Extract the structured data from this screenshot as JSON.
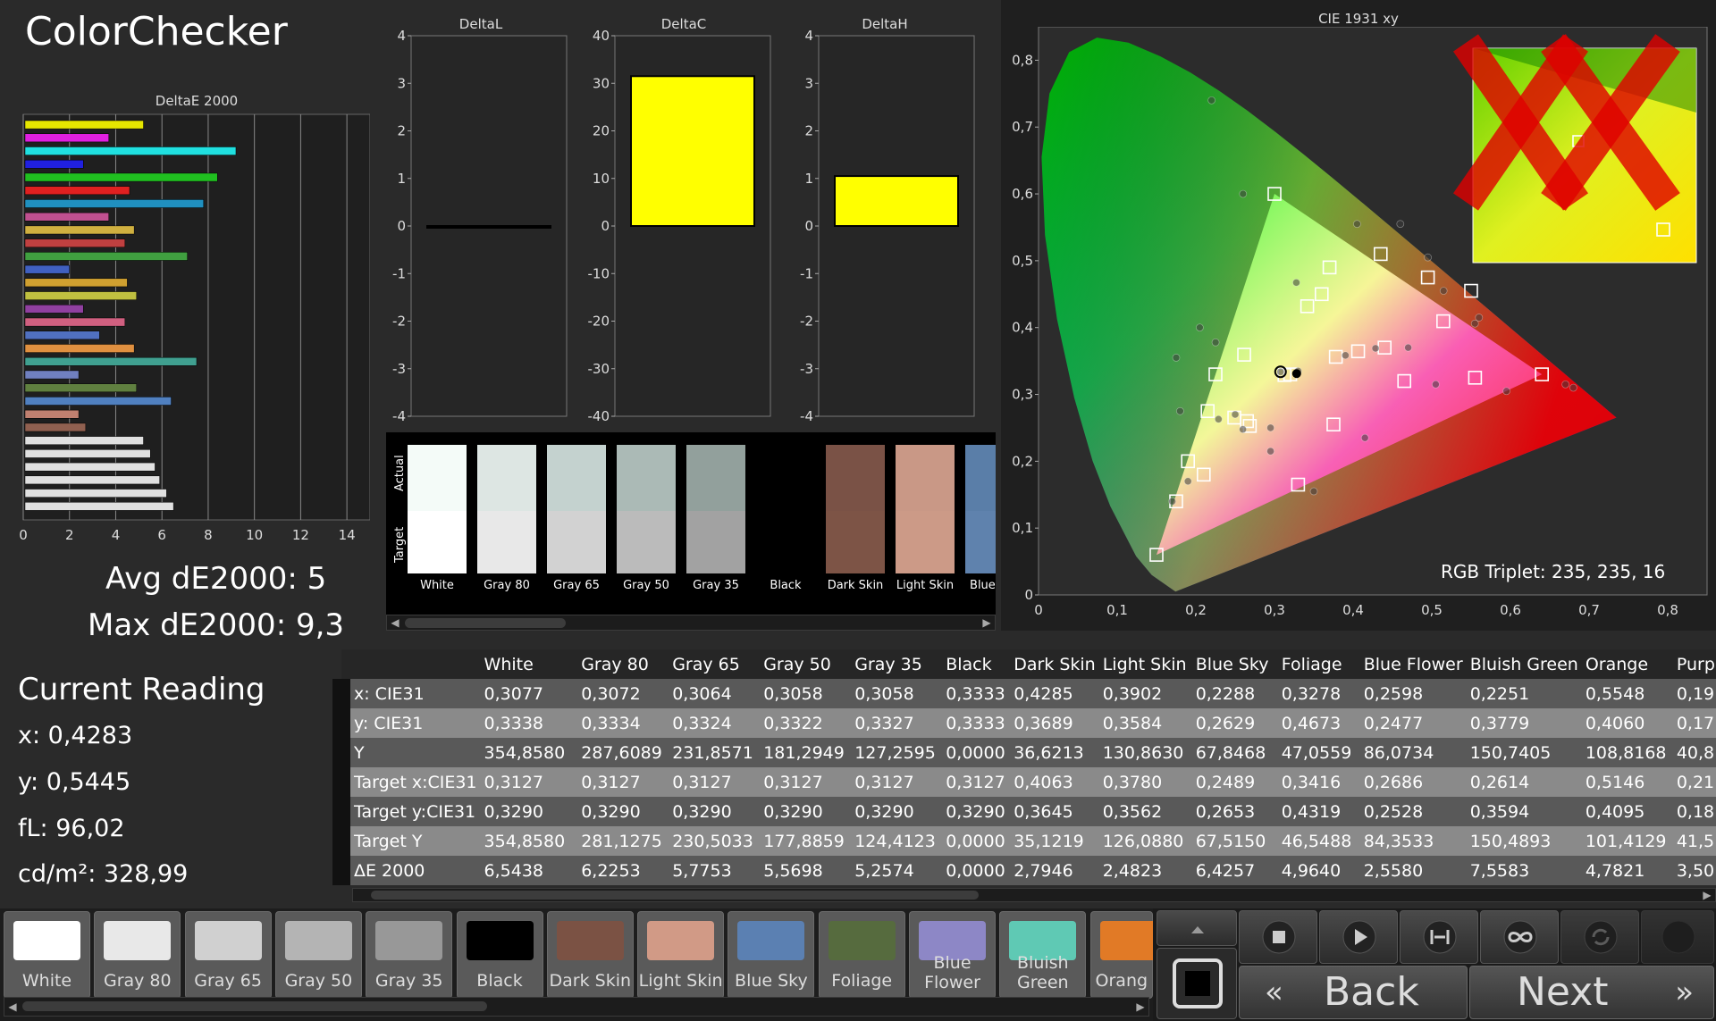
{
  "app": {
    "title": "ColorChecker"
  },
  "charts": {
    "deltae": {
      "title": "DeltaE 2000",
      "xticks": [
        "0",
        "2",
        "4",
        "6",
        "8",
        "10",
        "12",
        "14"
      ],
      "xmax": 15
    },
    "deltal": {
      "title": "DeltaL",
      "yticks": [
        "4",
        "3",
        "2",
        "1",
        "0",
        "-1",
        "-2",
        "-3",
        "-4"
      ],
      "ymin": -4,
      "ymax": 4,
      "value": 0.0,
      "color": "#111111"
    },
    "deltac": {
      "title": "DeltaC",
      "yticks": [
        "40",
        "30",
        "20",
        "10",
        "0",
        "-10",
        "-20",
        "-30",
        "-40"
      ],
      "ymin": -40,
      "ymax": 40,
      "value": 31.5,
      "color": "#ffff00"
    },
    "deltah": {
      "title": "DeltaH",
      "yticks": [
        "4",
        "3",
        "2",
        "1",
        "0",
        "-1",
        "-2",
        "-3",
        "-4"
      ],
      "ymin": -4,
      "ymax": 4,
      "value": 1.05,
      "color": "#ffff00"
    },
    "cie": {
      "title": "CIE 1931 xy",
      "xticks": [
        "0",
        "0,1",
        "0,2",
        "0,3",
        "0,4",
        "0,5",
        "0,6",
        "0,7",
        "0,8"
      ],
      "yticks": [
        "0,8",
        "0,7",
        "0,6",
        "0,5",
        "0,4",
        "0,3",
        "0,2",
        "0,1",
        "0"
      ],
      "rgb_triplet": "RGB Triplet: 235, 235, 16"
    }
  },
  "chart_data": [
    {
      "type": "bar",
      "title": "DeltaE 2000",
      "orientation": "horizontal",
      "xlim": [
        0,
        15
      ],
      "values": [
        5.2,
        3.7,
        9.2,
        2.6,
        8.4,
        4.6,
        7.8,
        3.7,
        4.8,
        4.4,
        7.1,
        2.0,
        4.5,
        4.9,
        2.6,
        4.4,
        3.3,
        4.8,
        7.5,
        2.4,
        4.9,
        6.4,
        2.4,
        2.7,
        5.2,
        5.5,
        5.7,
        5.9,
        6.2,
        6.5
      ],
      "colors": [
        "#e6e600",
        "#e020e0",
        "#20e0e0",
        "#2020e0",
        "#20c020",
        "#e02020",
        "#2090c0",
        "#c05090",
        "#d0b040",
        "#c04040",
        "#40a040",
        "#4060c0",
        "#d0a030",
        "#c0c040",
        "#9040a0",
        "#d06080",
        "#5070c0",
        "#e09040",
        "#40a090",
        "#7080c0",
        "#608040",
        "#5080c0",
        "#c08070",
        "#906050",
        "#e0e0e0",
        "#e0e0e0",
        "#e0e0e0",
        "#e0e0e0",
        "#e0e0e0",
        "#e0e0e0"
      ]
    },
    {
      "type": "bar",
      "title": "DeltaL",
      "categories": [
        ""
      ],
      "values": [
        0.0
      ],
      "ylim": [
        -4,
        4
      ]
    },
    {
      "type": "bar",
      "title": "DeltaC",
      "categories": [
        ""
      ],
      "values": [
        31.5
      ],
      "ylim": [
        -40,
        40
      ]
    },
    {
      "type": "bar",
      "title": "DeltaH",
      "categories": [
        ""
      ],
      "values": [
        1.05
      ],
      "ylim": [
        -4,
        4
      ]
    },
    {
      "type": "scatter",
      "title": "CIE 1931 xy",
      "xlim": [
        0,
        0.85
      ],
      "ylim": [
        0,
        0.85
      ],
      "gamut_triangle": [
        [
          0.64,
          0.33
        ],
        [
          0.3,
          0.6
        ],
        [
          0.15,
          0.06
        ]
      ],
      "targets": [
        [
          0.3127,
          0.329
        ],
        [
          0.4063,
          0.3645
        ],
        [
          0.378,
          0.3562
        ],
        [
          0.2489,
          0.2653
        ],
        [
          0.3416,
          0.4319
        ],
        [
          0.2686,
          0.2528
        ],
        [
          0.2614,
          0.3594
        ],
        [
          0.5146,
          0.4095
        ],
        [
          0.21,
          0.18
        ],
        [
          0.64,
          0.33
        ],
        [
          0.3,
          0.6
        ],
        [
          0.15,
          0.06
        ],
        [
          0.225,
          0.33
        ],
        [
          0.32,
          0.33
        ],
        [
          0.37,
          0.49
        ],
        [
          0.435,
          0.51
        ],
        [
          0.495,
          0.475
        ],
        [
          0.55,
          0.455
        ],
        [
          0.36,
          0.45
        ],
        [
          0.175,
          0.14
        ],
        [
          0.19,
          0.2
        ],
        [
          0.215,
          0.275
        ],
        [
          0.265,
          0.26
        ],
        [
          0.375,
          0.255
        ],
        [
          0.33,
          0.165
        ],
        [
          0.44,
          0.37
        ],
        [
          0.465,
          0.32
        ],
        [
          0.555,
          0.325
        ]
      ],
      "measured": [
        [
          0.3077,
          0.3338
        ],
        [
          0.4285,
          0.3689
        ],
        [
          0.3902,
          0.3584
        ],
        [
          0.2288,
          0.2629
        ],
        [
          0.3278,
          0.4673
        ],
        [
          0.2598,
          0.2477
        ],
        [
          0.2251,
          0.3779
        ],
        [
          0.5548,
          0.406
        ],
        [
          0.19,
          0.17
        ],
        [
          0.68,
          0.31
        ],
        [
          0.22,
          0.74
        ],
        [
          0.17,
          0.14
        ],
        [
          0.175,
          0.355
        ],
        [
          0.33,
          0.335
        ],
        [
          0.405,
          0.555
        ],
        [
          0.46,
          0.555
        ],
        [
          0.495,
          0.505
        ],
        [
          0.515,
          0.455
        ],
        [
          0.56,
          0.415
        ],
        [
          0.26,
          0.6
        ],
        [
          0.205,
          0.4
        ],
        [
          0.18,
          0.275
        ],
        [
          0.25,
          0.27
        ],
        [
          0.295,
          0.25
        ],
        [
          0.295,
          0.215
        ],
        [
          0.415,
          0.235
        ],
        [
          0.47,
          0.37
        ],
        [
          0.35,
          0.155
        ],
        [
          0.505,
          0.315
        ],
        [
          0.595,
          0.305
        ],
        [
          0.67,
          0.315
        ]
      ],
      "current": [
        0.3077,
        0.3338
      ]
    }
  ],
  "swatches": {
    "actual_label": "Actual",
    "target_label": "Target",
    "items": [
      {
        "label": "White",
        "actual": "#f4fbf8",
        "target": "#ffffff"
      },
      {
        "label": "Gray 80",
        "actual": "#dde6e3",
        "target": "#e8e8e8"
      },
      {
        "label": "Gray 65",
        "actual": "#c4d2cf",
        "target": "#d2d2d2"
      },
      {
        "label": "Gray 50",
        "actual": "#abbab6",
        "target": "#bbbbbb"
      },
      {
        "label": "Gray 35",
        "actual": "#92a09c",
        "target": "#a2a2a2"
      },
      {
        "label": "Black",
        "actual": "#000000",
        "target": "#000000"
      },
      {
        "label": "Dark Skin",
        "actual": "#7a5246",
        "target": "#7d5446"
      },
      {
        "label": "Light Skin",
        "actual": "#c99886",
        "target": "#cc9a87"
      },
      {
        "label": "Blue Sky",
        "actual": "#5a7ea8",
        "target": "#5f82ad"
      }
    ]
  },
  "stats": {
    "avg": "Avg dE2000: 5",
    "max": "Max dE2000: 9,3"
  },
  "current_reading": {
    "title": "Current Reading",
    "x": "x: 0,4283",
    "y": "y: 0,5445",
    "fl": "fL: 96,02",
    "cdm2": "cd/m²: 328,99"
  },
  "table": {
    "headers": [
      "",
      "White",
      "Gray 80",
      "Gray 65",
      "Gray 50",
      "Gray 35",
      "Black",
      "Dark Skin",
      "Light Skin",
      "Blue Sky",
      "Foliage",
      "Blue Flower",
      "Bluish Green",
      "Orange",
      "Purp"
    ],
    "rows": [
      [
        "x: CIE31",
        "0,3077",
        "0,3072",
        "0,3064",
        "0,3058",
        "0,3058",
        "0,3333",
        "0,4285",
        "0,3902",
        "0,2288",
        "0,3278",
        "0,2598",
        "0,2251",
        "0,5548",
        "0,19"
      ],
      [
        "y: CIE31",
        "0,3338",
        "0,3334",
        "0,3324",
        "0,3322",
        "0,3327",
        "0,3333",
        "0,3689",
        "0,3584",
        "0,2629",
        "0,4673",
        "0,2477",
        "0,3779",
        "0,4060",
        "0,17"
      ],
      [
        "Y",
        "354,8580",
        "287,6089",
        "231,8571",
        "181,2949",
        "127,2595",
        "0,0000",
        "36,6213",
        "130,8630",
        "67,8468",
        "47,0559",
        "86,0734",
        "150,7405",
        "108,8168",
        "40,8"
      ],
      [
        "Target x:CIE31",
        "0,3127",
        "0,3127",
        "0,3127",
        "0,3127",
        "0,3127",
        "0,3127",
        "0,4063",
        "0,3780",
        "0,2489",
        "0,3416",
        "0,2686",
        "0,2614",
        "0,5146",
        "0,21"
      ],
      [
        "Target y:CIE31",
        "0,3290",
        "0,3290",
        "0,3290",
        "0,3290",
        "0,3290",
        "0,3290",
        "0,3645",
        "0,3562",
        "0,2653",
        "0,4319",
        "0,2528",
        "0,3594",
        "0,4095",
        "0,18"
      ],
      [
        "Target Y",
        "354,8580",
        "281,1275",
        "230,5033",
        "177,8859",
        "124,4123",
        "0,0000",
        "35,1219",
        "126,0880",
        "67,5150",
        "46,5488",
        "84,3533",
        "150,4893",
        "101,4129",
        "41,5"
      ],
      [
        "ΔE 2000",
        "6,5438",
        "6,2253",
        "5,7753",
        "5,5698",
        "5,2574",
        "0,0000",
        "2,7946",
        "2,4823",
        "6,4257",
        "4,9640",
        "2,5580",
        "7,5583",
        "4,7821",
        "3,50"
      ]
    ]
  },
  "patches": [
    {
      "label": "White",
      "color": "#ffffff"
    },
    {
      "label": "Gray 80",
      "color": "#e8e8e8"
    },
    {
      "label": "Gray 65",
      "color": "#d0d0d0"
    },
    {
      "label": "Gray 50",
      "color": "#b4b4b4"
    },
    {
      "label": "Gray 35",
      "color": "#989898"
    },
    {
      "label": "Black",
      "color": "#000000"
    },
    {
      "label": "Dark Skin",
      "color": "#7b5244"
    },
    {
      "label": "Light Skin",
      "color": "#d19a86"
    },
    {
      "label": "Blue Sky",
      "color": "#5b80b2"
    },
    {
      "label": "Foliage",
      "color": "#566b3e"
    },
    {
      "label": "Blue\nFlower",
      "color": "#8d87c6"
    },
    {
      "label": "Bluish\nGreen",
      "color": "#5fc9b4"
    },
    {
      "label": "Orang",
      "color": "#e17a26"
    }
  ],
  "controls": {
    "back": "Back",
    "next": "Next",
    "stop_icon": "stop-icon",
    "play_icon": "play-icon",
    "fit_icon": "fit-icon",
    "loop_icon": "infinity-icon",
    "refresh_icon": "refresh-icon"
  },
  "colors": {
    "bg": "#2a2a2a",
    "panel": "#1f1f1f",
    "accent": "#ffff00",
    "locus_red": "#e00000"
  }
}
